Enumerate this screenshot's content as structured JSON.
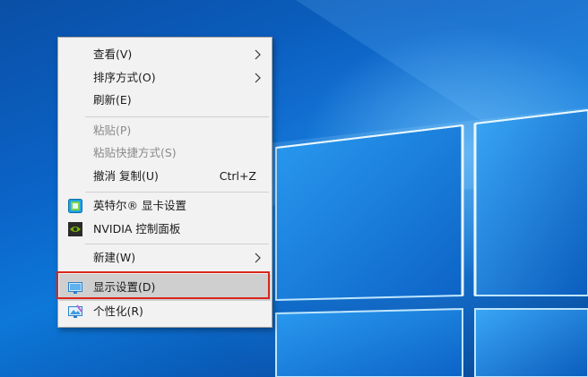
{
  "menu": {
    "items": [
      {
        "label": "查看(V)",
        "submenu": true
      },
      {
        "label": "排序方式(O)",
        "submenu": true
      },
      {
        "label": "刷新(E)"
      },
      {
        "label": "粘贴(P)",
        "disabled": true
      },
      {
        "label": "粘贴快捷方式(S)",
        "disabled": true
      },
      {
        "label": "撤消 复制(U)",
        "shortcut": "Ctrl+Z"
      },
      {
        "label": "英特尔® 显卡设置",
        "icon": "intel-graphics-icon"
      },
      {
        "label": "NVIDIA 控制面板",
        "icon": "nvidia-icon"
      },
      {
        "label": "新建(W)",
        "submenu": true
      },
      {
        "label": "显示设置(D)",
        "icon": "display-settings-icon",
        "highlighted": true
      },
      {
        "label": "个性化(R)",
        "icon": "personalize-icon"
      }
    ]
  },
  "colors": {
    "highlight_border": "#d9261c",
    "menu_background": "#f2f2f2",
    "desktop_blue": "#0b64c8"
  }
}
